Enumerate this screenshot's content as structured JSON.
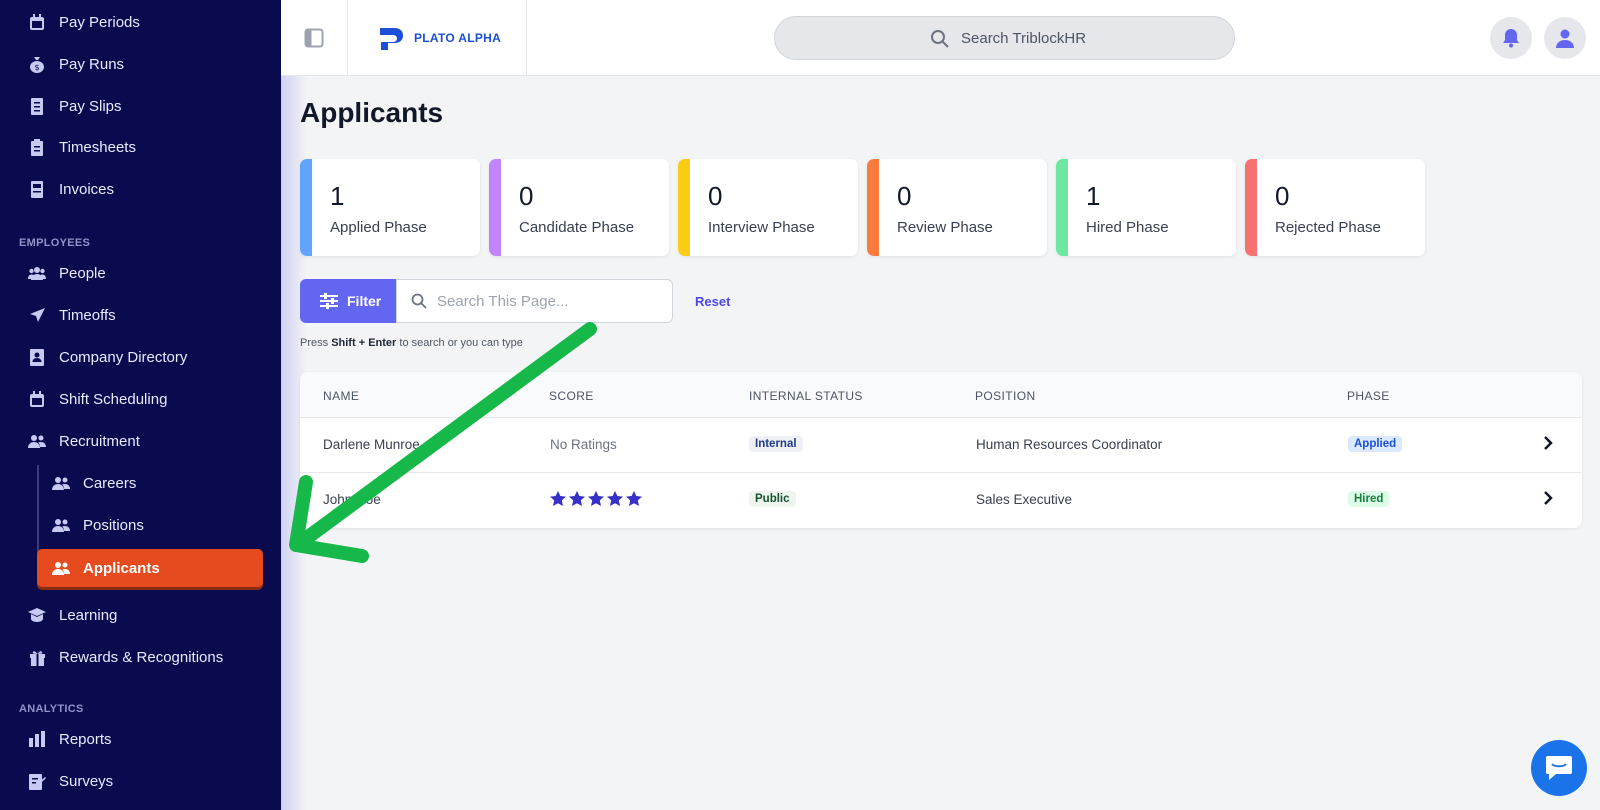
{
  "sidebar": {
    "items_top": [
      {
        "label": "Pay Periods",
        "icon": "calendar-icon"
      },
      {
        "label": "Pay Runs",
        "icon": "money-bag-icon"
      },
      {
        "label": "Pay Slips",
        "icon": "receipt-icon"
      },
      {
        "label": "Timesheets",
        "icon": "clipboard-icon"
      },
      {
        "label": "Invoices",
        "icon": "invoice-icon"
      }
    ],
    "section_employees": "EMPLOYEES",
    "items_employees": [
      {
        "label": "People",
        "icon": "users-icon"
      },
      {
        "label": "Timeoffs",
        "icon": "plane-icon"
      },
      {
        "label": "Company Directory",
        "icon": "contact-card-icon"
      },
      {
        "label": "Shift Scheduling",
        "icon": "calendar-icon"
      },
      {
        "label": "Recruitment",
        "icon": "users-icon"
      }
    ],
    "items_recruitment": [
      {
        "label": "Careers",
        "icon": "users-icon"
      },
      {
        "label": "Positions",
        "icon": "users-icon"
      },
      {
        "label": "Applicants",
        "icon": "users-icon",
        "active": true
      }
    ],
    "items_after": [
      {
        "label": "Learning",
        "icon": "graduation-cap-icon"
      },
      {
        "label": "Rewards & Recognitions",
        "icon": "gift-icon"
      }
    ],
    "section_analytics": "ANALYTICS",
    "items_analytics": [
      {
        "label": "Reports",
        "icon": "bar-chart-icon"
      },
      {
        "label": "Surveys",
        "icon": "survey-icon"
      }
    ]
  },
  "topbar": {
    "logo_text": "PLATO ALPHA",
    "search_placeholder": "Search TriblockHR"
  },
  "page": {
    "title": "Applicants"
  },
  "stats": [
    {
      "value": "1",
      "label": "Applied Phase",
      "color": "#60a5fa"
    },
    {
      "value": "0",
      "label": "Candidate Phase",
      "color": "#c084fc"
    },
    {
      "value": "0",
      "label": "Interview Phase",
      "color": "#facc15"
    },
    {
      "value": "0",
      "label": "Review Phase",
      "color": "#fb7a3c"
    },
    {
      "value": "1",
      "label": "Hired Phase",
      "color": "#6ee7a0"
    },
    {
      "value": "0",
      "label": "Rejected Phase",
      "color": "#f87171"
    }
  ],
  "filter": {
    "button_label": "Filter",
    "search_placeholder": "Search This Page...",
    "reset_label": "Reset",
    "hint_prefix": "Press",
    "hint_key1": "Shift",
    "hint_plus": "+",
    "hint_key2": "Enter",
    "hint_suffix": "to search or you can type"
  },
  "table": {
    "headers": [
      "NAME",
      "SCORE",
      "INTERNAL STATUS",
      "POSITION",
      "PHASE"
    ],
    "rows": [
      {
        "name": "Darlene Munroe",
        "score": "No Ratings",
        "rating": 0,
        "status": "Internal",
        "position": "Human Resources Coordinator",
        "phase": "Applied"
      },
      {
        "name": "John Doe",
        "score": "",
        "rating": 5,
        "status": "Public",
        "position": "Sales Executive",
        "phase": "Hired"
      }
    ]
  },
  "colors": {
    "sidebar_bg": "#0a0a4e",
    "active_item": "#e54b1f",
    "accent": "#6366f1",
    "annotation_arrow": "#16b84a"
  }
}
